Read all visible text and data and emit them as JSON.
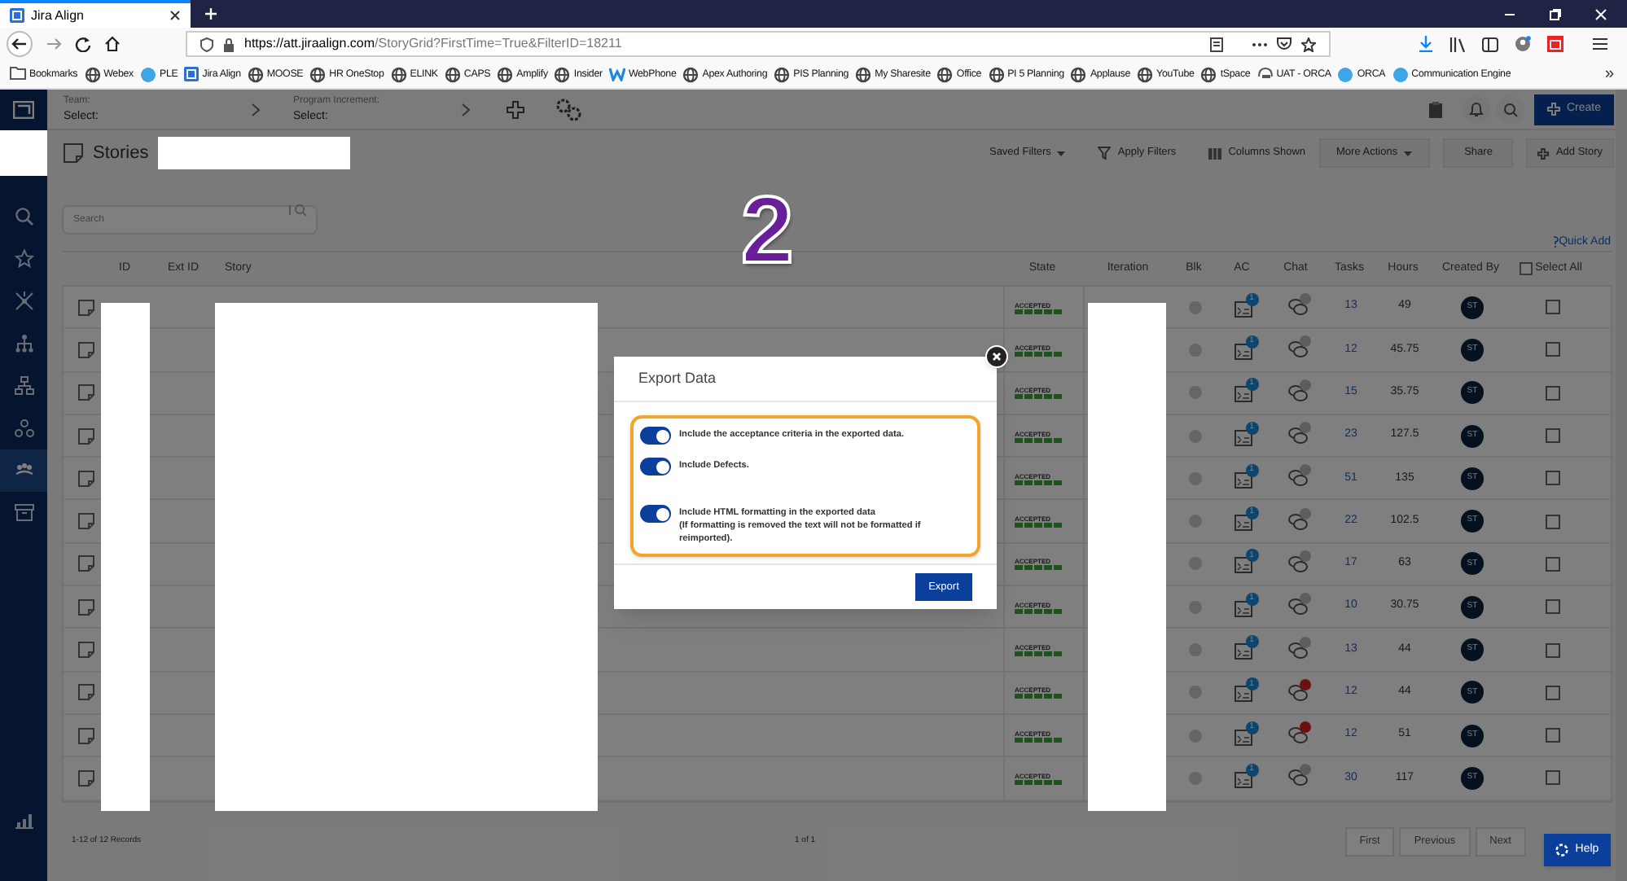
{
  "browser": {
    "tab_title": "Jira Align",
    "url_host": "https://att.jiraalign.com",
    "url_path": "/StoryGrid?FirstTime=True&FilterID=18211",
    "bookmarks": [
      {
        "label": "Bookmarks",
        "kind": "folder"
      },
      {
        "label": "Webex",
        "kind": "globe"
      },
      {
        "label": "PLE",
        "kind": "ball"
      },
      {
        "label": "Jira Align",
        "kind": "app"
      },
      {
        "label": "MOOSE",
        "kind": "globe"
      },
      {
        "label": "HR OneStop",
        "kind": "globe"
      },
      {
        "label": "ELINK",
        "kind": "globe"
      },
      {
        "label": "CAPS",
        "kind": "globe"
      },
      {
        "label": "Amplify",
        "kind": "globe"
      },
      {
        "label": "Insider",
        "kind": "globe"
      },
      {
        "label": "WebPhone",
        "kind": "w"
      },
      {
        "label": "Apex Authoring",
        "kind": "globe"
      },
      {
        "label": "PIS Planning",
        "kind": "globe"
      },
      {
        "label": "My Sharesite",
        "kind": "globe"
      },
      {
        "label": "Office",
        "kind": "globe"
      },
      {
        "label": "PI 5 Planning",
        "kind": "globe"
      },
      {
        "label": "Applause",
        "kind": "globe"
      },
      {
        "label": "YouTube",
        "kind": "globe"
      },
      {
        "label": "tSpace",
        "kind": "globe"
      },
      {
        "label": "UAT - ORCA",
        "kind": "phone"
      },
      {
        "label": "ORCA",
        "kind": "ball"
      },
      {
        "label": "Communication Engine",
        "kind": "ball"
      }
    ],
    "overflow": "»"
  },
  "sidebar": {
    "items": [
      {
        "selected": false
      },
      {
        "selected": false
      },
      {
        "selected": false
      },
      {
        "selected": false
      },
      {
        "selected": false
      },
      {
        "selected": false
      },
      {
        "selected": true
      },
      {
        "selected": false
      }
    ]
  },
  "header": {
    "team_label": "Team:",
    "team_value": "Select:",
    "pi_label": "Program Increment:",
    "pi_value": "Select:",
    "create": "Create"
  },
  "page": {
    "title": "Stories",
    "actions": [
      {
        "label": "Saved Filters",
        "kind": "dropdown"
      },
      {
        "label": "Apply Filters",
        "kind": "filter"
      },
      {
        "label": "Columns Shown",
        "kind": "columns"
      },
      {
        "label": "More Actions",
        "kind": "button-dropdown"
      },
      {
        "label": "Share",
        "kind": "button"
      },
      {
        "label": "Add Story",
        "kind": "button-add"
      }
    ],
    "search_placeholder": "Search",
    "quick_add": "Quick Add",
    "annotation": "2"
  },
  "table": {
    "select_all_checked": false,
    "columns": [
      "ID",
      "Ext ID",
      "Story",
      "State",
      "Iteration",
      "Blk",
      "AC",
      "Chat",
      "Tasks",
      "Hours",
      "Created By",
      "Select All"
    ],
    "rows": [
      {
        "state": "ACCEPTED",
        "level": 1,
        "ac": "1",
        "chat_unread": false,
        "tasks": "13",
        "hours": "49",
        "created_by": "ST",
        "checked": false
      },
      {
        "state": "ACCEPTED",
        "level": 1,
        "ac": "1",
        "chat_unread": false,
        "tasks": "12",
        "hours": "45.75",
        "created_by": "ST",
        "checked": false
      },
      {
        "state": "ACCEPTED",
        "level": 1,
        "ac": "1",
        "chat_unread": false,
        "tasks": "15",
        "hours": "35.75",
        "created_by": "ST",
        "checked": false
      },
      {
        "state": "ACCEPTED",
        "level": 1,
        "ac": "1",
        "chat_unread": false,
        "tasks": "23",
        "hours": "127.5",
        "created_by": "ST",
        "checked": false
      },
      {
        "state": "ACCEPTED",
        "level": 1,
        "ac": "1",
        "chat_unread": false,
        "tasks": "51",
        "hours": "135",
        "created_by": "ST",
        "checked": false
      },
      {
        "state": "ACCEPTED",
        "level": 1,
        "ac": "1",
        "chat_unread": false,
        "tasks": "22",
        "hours": "102.5",
        "created_by": "ST",
        "checked": false
      },
      {
        "state": "ACCEPTED",
        "level": 1,
        "ac": "1",
        "chat_unread": false,
        "tasks": "17",
        "hours": "63",
        "created_by": "ST",
        "checked": false
      },
      {
        "state": "ACCEPTED",
        "level": 1,
        "ac": "1",
        "chat_unread": false,
        "tasks": "10",
        "hours": "30.75",
        "created_by": "ST",
        "checked": false
      },
      {
        "state": "ACCEPTED",
        "level": 1,
        "ac": "1",
        "chat_unread": false,
        "tasks": "13",
        "hours": "44",
        "created_by": "ST",
        "checked": false
      },
      {
        "state": "ACCEPTED",
        "level": 1,
        "ac": "1",
        "chat_unread": true,
        "tasks": "12",
        "hours": "44",
        "created_by": "ST",
        "checked": false
      },
      {
        "state": "ACCEPTED",
        "level": 1,
        "ac": "1",
        "chat_unread": true,
        "tasks": "12",
        "hours": "51",
        "created_by": "ST",
        "checked": false
      },
      {
        "state": "ACCEPTED",
        "level": 1,
        "ac": "1",
        "chat_unread": false,
        "tasks": "30",
        "hours": "117",
        "created_by": "ST",
        "checked": false
      }
    ]
  },
  "footer": {
    "records": "1-12 of 12 Records",
    "page": "1 of 1",
    "buttons": [
      "First",
      "Previous",
      "Next"
    ],
    "help": "Help"
  },
  "dialog": {
    "title": "Export Data",
    "options": [
      {
        "text": "Include the acceptance criteria in the exported data.",
        "on": true
      },
      {
        "text": "Include Defects.",
        "on": true
      },
      {
        "text": "Include HTML formatting in the exported data\n(If formatting is removed the text will not be formatted if reimported).",
        "on": true
      }
    ],
    "button": "Export"
  }
}
